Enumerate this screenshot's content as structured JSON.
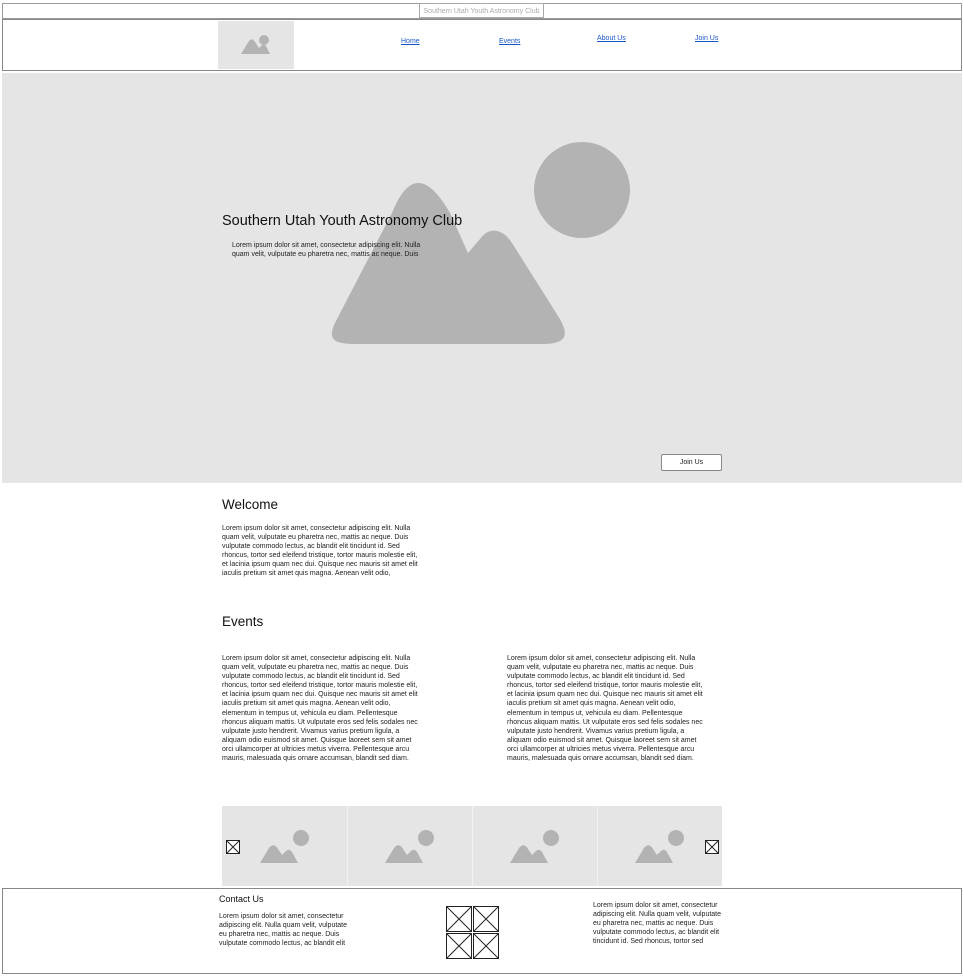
{
  "browser": {
    "tab_title": "Southern Utah Youth Astronomy Club"
  },
  "header": {
    "logo_icon": "image-placeholder-icon",
    "nav": [
      {
        "label": "Home"
      },
      {
        "label": "Events"
      },
      {
        "label": "About Us"
      },
      {
        "label": "Join Us"
      }
    ]
  },
  "hero": {
    "title": "Southern Utah Youth Astronomy Club",
    "text": "Lorem ipsum dolor sit amet, consectetur adipiscing elit. Nulla quam velit, vulputate eu pharetra nec, mattis ac neque. Duis",
    "button": "Join Us"
  },
  "welcome": {
    "heading": "Welcome",
    "text": "Lorem ipsum dolor sit amet, consectetur adipiscing elit. Nulla quam velit, vulputate eu pharetra nec, mattis ac neque. Duis vulputate commodo lectus, ac blandit elit tincidunt id. Sed rhoncus, tortor sed eleifend tristique, tortor mauris molestie elit, et lacinia ipsum quam nec dui. Quisque nec mauris sit amet elit iaculis pretium sit amet quis magna. Aenean velit odio,"
  },
  "events": {
    "heading": "Events",
    "col1": "Lorem ipsum dolor sit amet, consectetur adipiscing elit. Nulla quam velit, vulputate eu pharetra nec, mattis ac neque. Duis vulputate commodo lectus, ac blandit elit tincidunt id. Sed rhoncus, tortor sed eleifend tristique, tortor mauris molestie elit, et lacinia ipsum quam nec dui. Quisque nec mauris sit amet elit iaculis pretium sit amet quis magna. Aenean velit odio, elementum in tempus ut, vehicula eu diam. Pellentesque rhoncus aliquam mattis. Ut vulputate eros sed felis sodales nec vulputate justo hendrerit. Vivamus varius pretium ligula, a aliquam odio euismod sit amet. Quisque laoreet sem sit amet orci ullamcorper at ultricies metus viverra. Pellentesque arcu mauris, malesuada quis ornare accumsan, blandit sed diam.",
    "col2": "Lorem ipsum dolor sit amet, consectetur adipiscing elit. Nulla quam velit, vulputate eu pharetra nec, mattis ac neque. Duis vulputate commodo lectus, ac blandit elit tincidunt id. Sed rhoncus, tortor sed eleifend tristique, tortor mauris molestie elit, et lacinia ipsum quam nec dui. Quisque nec mauris sit amet elit iaculis pretium sit amet quis magna. Aenean velit odio, elementum in tempus ut, vehicula eu diam. Pellentesque rhoncus aliquam mattis. Ut vulputate eros sed felis sodales nec vulputate justo hendrerit. Vivamus varius pretium ligula, a aliquam odio euismod sit amet. Quisque laoreet sem sit amet orci ullamcorper at ultricies metus viverra. Pellentesque arcu mauris, malesuada quis ornare accumsan, blandit sed diam."
  },
  "gallery": {
    "prev_icon": "x-box-icon",
    "next_icon": "x-box-icon",
    "images": [
      "image-placeholder-icon",
      "image-placeholder-icon",
      "image-placeholder-icon",
      "image-placeholder-icon"
    ]
  },
  "footer": {
    "contact_heading": "Contact Us",
    "contact_text": "Lorem ipsum dolor sit amet, consectetur adipiscing elit. Nulla quam velit, vulputate eu pharetra nec, mattis ac neque. Duis vulputate commodo lectus, ac blandit elit",
    "right_text": "Lorem ipsum dolor sit amet, consectetur adipiscing elit. Nulla quam velit, vulputate eu pharetra nec, mattis ac neque. Duis vulputate commodo lectus, ac blandit elit tincidunt id. Sed rhoncus, tortor sed",
    "social_icon": "x-box-icon"
  }
}
